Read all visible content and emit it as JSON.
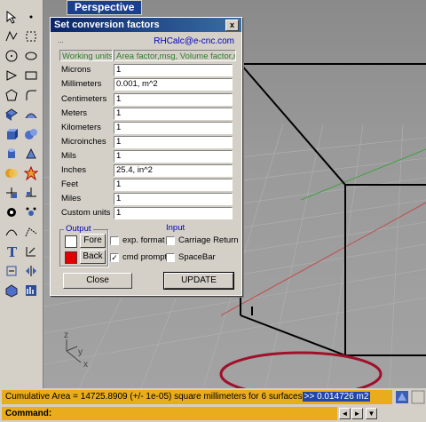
{
  "viewport": {
    "title": "Perspective"
  },
  "axis": {
    "x": "x",
    "y": "y",
    "z": "z"
  },
  "dialog": {
    "title": "Set conversion factors",
    "close_label": "x",
    "email": "RHCalc@e-cnc.com",
    "dots": "...",
    "headers": {
      "units": "Working units",
      "factors": "Area factor,msg, Volume factor,msg"
    },
    "rows": [
      {
        "label": "Microns",
        "value": "1"
      },
      {
        "label": "Millimeters",
        "value": "0.001, m^2"
      },
      {
        "label": "Centimeters",
        "value": "1"
      },
      {
        "label": "Meters",
        "value": "1"
      },
      {
        "label": "Kilometers",
        "value": "1"
      },
      {
        "label": "Microinches",
        "value": "1"
      },
      {
        "label": "Mils",
        "value": "1"
      },
      {
        "label": "Inches",
        "value": "25.4, in^2"
      },
      {
        "label": "Feet",
        "value": "1"
      },
      {
        "label": "Miles",
        "value": "1"
      },
      {
        "label": "Custom units",
        "value": "1"
      }
    ],
    "output": {
      "label": "Output",
      "fore_label": "Fore",
      "back_label": "Back",
      "fore_color": "#ffffff",
      "back_color": "#e00000"
    },
    "input_group": {
      "label": "Input"
    },
    "options": {
      "exp_format": {
        "label": "exp. format",
        "checked": false
      },
      "cmd_prompt": {
        "label": "cmd prompt",
        "checked": true
      },
      "carriage_return": {
        "label": "Carriage Return",
        "checked": false
      },
      "spacebar": {
        "label": "SpaceBar",
        "checked": false
      }
    },
    "close_button": "Close",
    "update_button": "UPDATE"
  },
  "command": {
    "history_text": "Cumulative Area = 14725.8909 (+/- 1e-05) square millimeters for 6 surfaces",
    "history_highlight": ">> 0.014726 m2",
    "prompt": "Command:"
  },
  "colors": {
    "title_bar": "#0a246a",
    "command_bg": "#e8ac1c",
    "highlight": "#2145a8",
    "annotation": "#a0102a"
  }
}
